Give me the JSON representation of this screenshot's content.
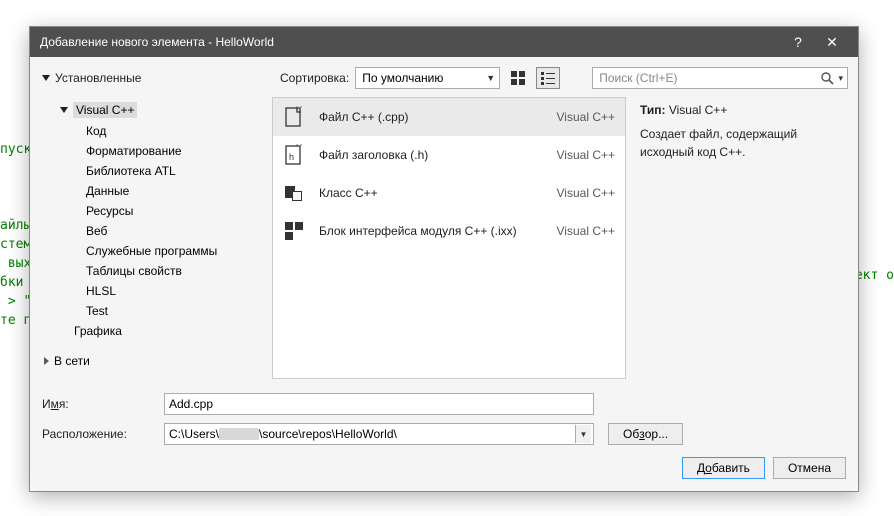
{
  "bg": {
    "lines": "пуск\n\n\n\nайлы\nстеме\n выхо\nбки\n > \"\nте пу",
    "right": "ект о"
  },
  "dialog": {
    "title": "Добавление нового элемента  - HelloWorld",
    "help": "?",
    "close": "✕"
  },
  "tree_header": "Установленные",
  "sort": {
    "label": "Сортировка:",
    "value": "По умолчанию"
  },
  "search": {
    "placeholder": "Поиск (Ctrl+E)"
  },
  "tree": {
    "root": "Visual C++",
    "children": [
      "Код",
      "Форматирование",
      "Библиотека ATL",
      "Данные",
      "Ресурсы",
      "Веб",
      "Служебные программы",
      "Таблицы свойств",
      "HLSL",
      "Test"
    ],
    "graphics": "Графика",
    "online": "В сети"
  },
  "templates": [
    {
      "name": "Файл C++ (.cpp)",
      "tag": "Visual C++"
    },
    {
      "name": "Файл заголовка (.h)",
      "tag": "Visual C++"
    },
    {
      "name": "Класс C++",
      "tag": "Visual C++"
    },
    {
      "name": "Блок интерфейса модуля C++ (.ixx)",
      "tag": "Visual C++"
    }
  ],
  "info": {
    "type_label": "Тип:",
    "type_value": "Visual C++",
    "description": "Создает файл, содержащий исходный код C++."
  },
  "form": {
    "name_label_pre": "И",
    "name_label_u": "м",
    "name_label_post": "я:",
    "name_value": "Add.cpp",
    "location_label": "Расположение:",
    "location_pre": "C:\\Users\\",
    "location_post": "\\source\\repos\\HelloWorld\\",
    "browse_label_pre": "Об",
    "browse_label_u": "з",
    "browse_label_post": "ор..."
  },
  "buttons": {
    "add_pre": "Д",
    "add_u": "о",
    "add_post": "бавить",
    "cancel": "Отмена"
  }
}
